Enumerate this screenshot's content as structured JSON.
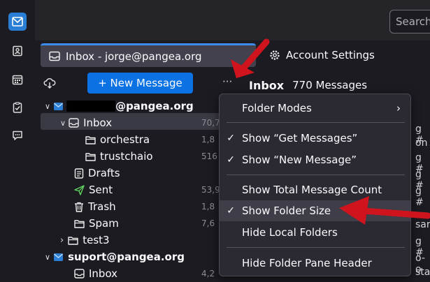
{
  "window": {
    "search_placeholder": "Search"
  },
  "tabs": [
    {
      "label": "Inbox - jorge@pangea.org",
      "icon": "inbox-icon"
    },
    {
      "label": "Account Settings",
      "icon": "gear-icon"
    }
  ],
  "folder_pane": {
    "new_message_label": "+ New Message",
    "menu_label": "···",
    "tree": [
      {
        "name": "@pangea.org",
        "size": "",
        "type": "account"
      },
      {
        "name": "Inbox",
        "size": "70,7",
        "type": "inbox"
      },
      {
        "name": "orchestra",
        "size": "1,8",
        "type": "folder"
      },
      {
        "name": "trustchaio",
        "size": "516",
        "type": "folder"
      },
      {
        "name": "Drafts",
        "size": "",
        "type": "drafts"
      },
      {
        "name": "Sent",
        "size": "53,9",
        "type": "sent"
      },
      {
        "name": "Trash",
        "size": "1,8",
        "type": "trash"
      },
      {
        "name": "Spam",
        "size": "7,6",
        "type": "spam"
      },
      {
        "name": "test3",
        "size": "",
        "type": "folder"
      },
      {
        "name": "suport@pangea.org",
        "size": "",
        "type": "account"
      },
      {
        "name": "Inbox",
        "size": "4,2",
        "type": "inbox"
      }
    ]
  },
  "message_pane": {
    "title": "Inbox",
    "count": "770 Messages",
    "row_fragments": [
      "g #",
      "on",
      "g #",
      "g #",
      "g #",
      "sar",
      "g #",
      "o-o",
      "sta"
    ]
  },
  "context_menu": {
    "items": [
      {
        "label": "Folder Modes",
        "checked": false,
        "submenu": true
      },
      {
        "label": "Show “Get Messages”",
        "checked": true
      },
      {
        "label": "Show “New Message”",
        "checked": true
      },
      {
        "label": "Show Total Message Count",
        "checked": false
      },
      {
        "label": "Show Folder Size",
        "checked": true
      },
      {
        "label": "Hide Local Folders",
        "checked": false
      },
      {
        "label": "Hide Folder Pane Header",
        "checked": false
      }
    ],
    "check_glyph": "✓",
    "submenu_glyph": "›"
  },
  "colors": {
    "accent": "#0a72e3",
    "annotation": "#d0141e"
  }
}
